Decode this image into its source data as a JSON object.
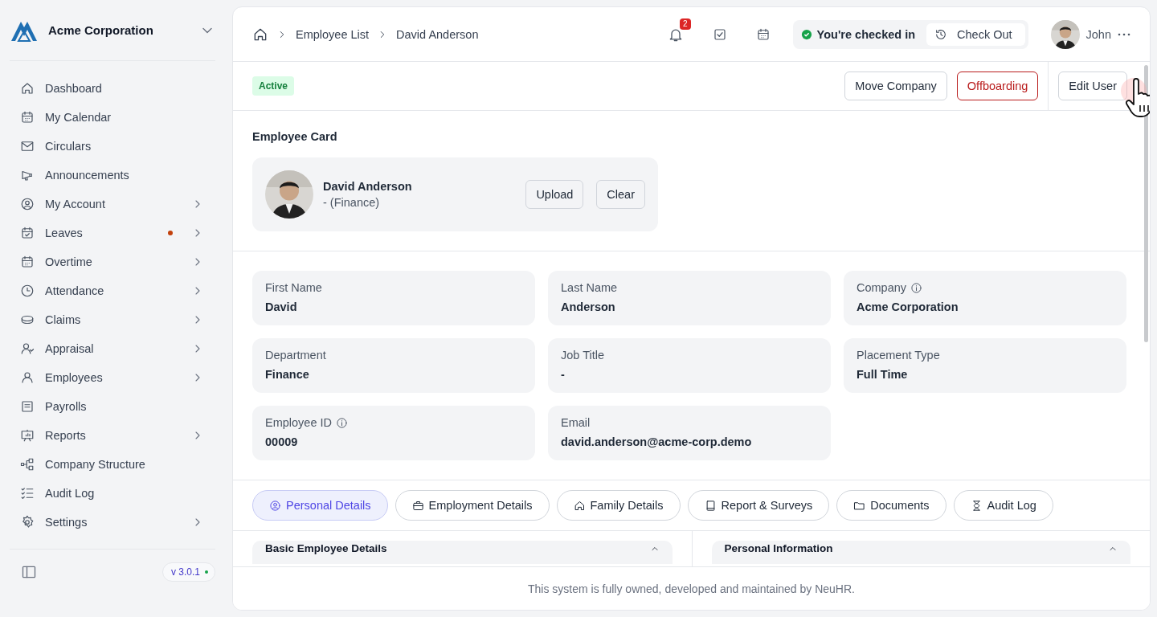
{
  "company": {
    "name": "Acme Corporation"
  },
  "nav": [
    {
      "label": "Dashboard",
      "submenu": false,
      "alert": false
    },
    {
      "label": "My Calendar",
      "submenu": false,
      "alert": false
    },
    {
      "label": "Circulars",
      "submenu": false,
      "alert": false
    },
    {
      "label": "Announcements",
      "submenu": false,
      "alert": false
    },
    {
      "label": "My Account",
      "submenu": true,
      "alert": false
    },
    {
      "label": "Leaves",
      "submenu": true,
      "alert": true
    },
    {
      "label": "Overtime",
      "submenu": true,
      "alert": false
    },
    {
      "label": "Attendance",
      "submenu": true,
      "alert": false
    },
    {
      "label": "Claims",
      "submenu": true,
      "alert": false
    },
    {
      "label": "Appraisal",
      "submenu": true,
      "alert": false
    },
    {
      "label": "Employees",
      "submenu": true,
      "alert": false
    },
    {
      "label": "Payrolls",
      "submenu": false,
      "alert": false
    },
    {
      "label": "Reports",
      "submenu": true,
      "alert": false
    },
    {
      "label": "Company Structure",
      "submenu": false,
      "alert": false
    },
    {
      "label": "Audit Log",
      "submenu": false,
      "alert": false
    },
    {
      "label": "Settings",
      "submenu": true,
      "alert": false
    }
  ],
  "version": "v 3.0.1",
  "breadcrumb": [
    "Employee List",
    "David Anderson"
  ],
  "notifications": {
    "count": "2"
  },
  "check_in": {
    "status": "You're checked in",
    "action": "Check Out"
  },
  "user": {
    "name": "John"
  },
  "status_badge": "Active",
  "actions": [
    {
      "label": "Move Company",
      "kind": "default"
    },
    {
      "label": "Offboarding",
      "kind": "danger"
    },
    {
      "label": "Edit User",
      "kind": "default"
    }
  ],
  "employee_card": {
    "title": "Employee Card",
    "name": "David Anderson",
    "subtitle": "- (Finance)",
    "buttons": [
      "Upload",
      "Clear"
    ]
  },
  "fields": [
    {
      "label": "First Name",
      "value": "David",
      "info": false
    },
    {
      "label": "Last Name",
      "value": "Anderson",
      "info": false
    },
    {
      "label": "Company",
      "value": "Acme Corporation",
      "info": true
    },
    {
      "label": "Department",
      "value": "Finance",
      "info": false
    },
    {
      "label": "Job Title",
      "value": "-",
      "info": false
    },
    {
      "label": "Placement Type",
      "value": "Full Time",
      "info": false
    },
    {
      "label": "Employee ID",
      "value": "00009",
      "info": true
    },
    {
      "label": "Email",
      "value": "david.anderson@acme-corp.demo",
      "info": false
    }
  ],
  "tabs": [
    {
      "label": "Personal Details",
      "selected": true
    },
    {
      "label": "Employment Details",
      "selected": false
    },
    {
      "label": "Family Details",
      "selected": false
    },
    {
      "label": "Report & Surveys",
      "selected": false
    },
    {
      "label": "Documents",
      "selected": false
    },
    {
      "label": "Audit Log",
      "selected": false
    }
  ],
  "panels": [
    "Basic Employee Details",
    "Personal Information"
  ],
  "footer": "This system is fully owned, developed and maintained by NeuHR."
}
